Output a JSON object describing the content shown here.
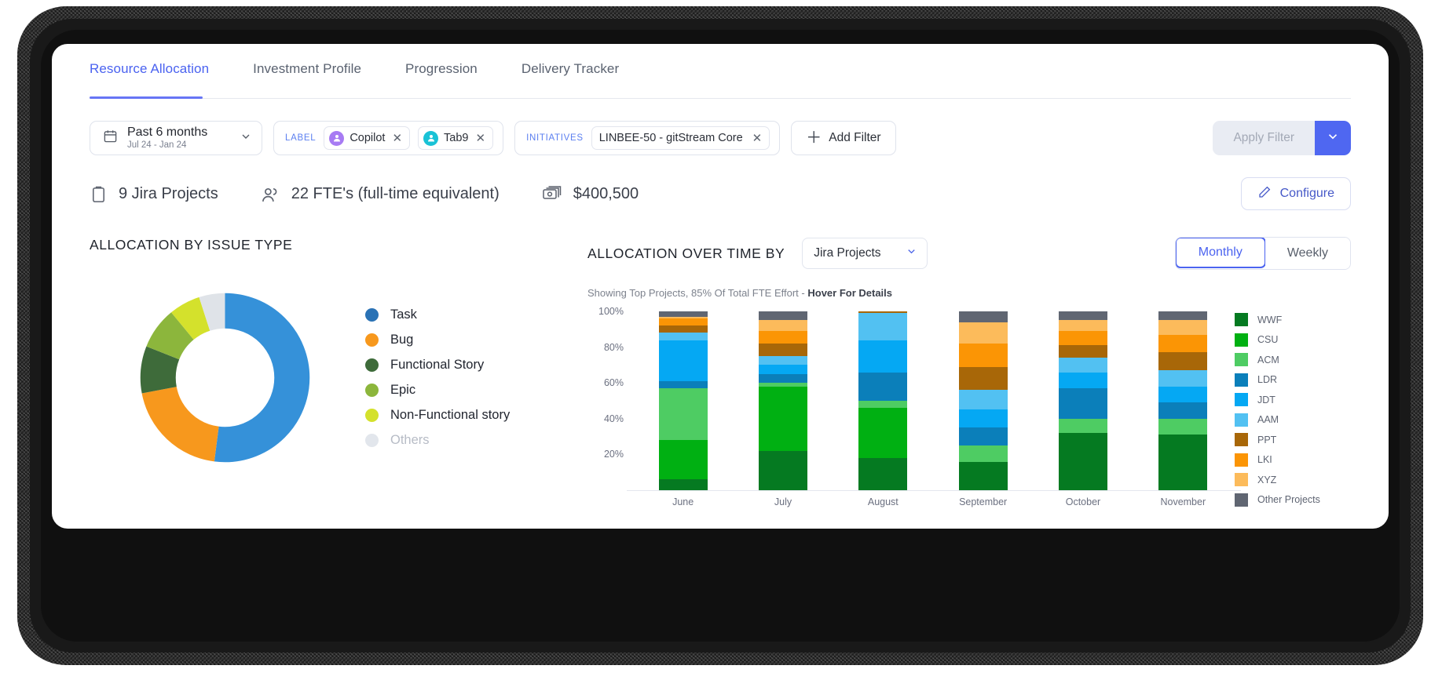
{
  "tabs": [
    {
      "label": "Resource Allocation",
      "active": true
    },
    {
      "label": "Investment Profile",
      "active": false
    },
    {
      "label": "Progression",
      "active": false
    },
    {
      "label": "Delivery Tracker",
      "active": false
    }
  ],
  "filters": {
    "date_range": {
      "title": "Past 6 months",
      "subtitle": "Jul 24 - Jan 24",
      "icon": "calendar-icon"
    },
    "label_group": {
      "label": "LABEL",
      "chips": [
        {
          "text": "Copilot",
          "avatar_color": "#a77bf3"
        },
        {
          "text": "Tab9",
          "avatar_color": "#19c2d6"
        }
      ]
    },
    "initiatives_group": {
      "label": "INITIATIVES",
      "chips": [
        {
          "text": "LINBEE-50 - gitStream Core"
        }
      ]
    },
    "add_filter": "Add Filter",
    "apply_filter": "Apply Filter",
    "apply_caret_color": "#4f67f1"
  },
  "stats": [
    {
      "icon": "clipboard-icon",
      "text": "9 Jira Projects"
    },
    {
      "icon": "people-icon",
      "text": "22 FTE's (full-time equivalent)"
    },
    {
      "icon": "money-icon",
      "text": "$400,500"
    }
  ],
  "configure_button": {
    "label": "Configure",
    "icon": "pencil-icon"
  },
  "left_panel": {
    "title": "ALLOCATION BY ISSUE TYPE"
  },
  "right_panel": {
    "title": "ALLOCATION OVER TIME BY",
    "group_by_selected": "Jira Projects",
    "period_monthly": "Monthly",
    "period_weekly": "Weekly",
    "subnote_plain": "Showing Top Projects, 85% Of Total FTE Effort  - ",
    "subnote_bold": "Hover For Details"
  },
  "chart_data": [
    {
      "type": "pie",
      "title": "ALLOCATION BY ISSUE TYPE",
      "donut": true,
      "legend_position": "right",
      "labels": [
        "Task",
        "Bug",
        "Functional Story",
        "Epic",
        "Non-Functional story",
        "Others"
      ],
      "values": [
        52,
        20,
        9,
        8,
        6,
        5
      ],
      "colors": [
        "#3591d9",
        "#f7981d",
        "#3e6b3a",
        "#8cb63c",
        "#d4e12c",
        "#dfe3e8"
      ],
      "legend_colors": [
        "#2a72b5",
        "#f7981d",
        "#3e6b3a",
        "#8cb63c",
        "#d4e12c",
        "#e2e6ec"
      ],
      "muted_labels": [
        "Others"
      ]
    },
    {
      "type": "bar",
      "stacked": true,
      "title": "ALLOCATION OVER TIME BY Jira Projects",
      "xlabel": "",
      "ylabel": "",
      "ylim": [
        0,
        100
      ],
      "yticks": [
        20,
        40,
        60,
        80,
        100
      ],
      "ytick_labels": [
        "20%",
        "40%",
        "60%",
        "80%",
        "100%"
      ],
      "grid": false,
      "legend_position": "right",
      "categories": [
        "June",
        "July",
        "August",
        "September",
        "October",
        "November"
      ],
      "series": [
        {
          "name": "WWF",
          "color": "#057a21",
          "values": [
            6,
            22,
            18,
            16,
            32,
            31
          ]
        },
        {
          "name": "CSU",
          "color": "#00b012",
          "values": [
            22,
            36,
            28,
            0,
            0,
            0
          ]
        },
        {
          "name": "ACM",
          "color": "#4ecc63",
          "values": [
            29,
            2,
            4,
            9,
            8,
            9
          ]
        },
        {
          "name": "LDR",
          "color": "#0b7fba",
          "values": [
            4,
            5,
            16,
            10,
            17,
            9
          ]
        },
        {
          "name": "JDT",
          "color": "#05a8f3",
          "values": [
            23,
            5,
            18,
            10,
            9,
            9
          ]
        },
        {
          "name": "AAM",
          "color": "#52c1f2",
          "values": [
            4,
            5,
            15,
            11,
            8,
            9
          ]
        },
        {
          "name": "PPT",
          "color": "#a86708",
          "values": [
            4,
            7,
            1,
            13,
            7,
            10
          ]
        },
        {
          "name": "LKI",
          "color": "#fb9505",
          "values": [
            4,
            7,
            0,
            13,
            8,
            10
          ]
        },
        {
          "name": "XYZ",
          "color": "#fcbb5b",
          "values": [
            1,
            6,
            0,
            12,
            6,
            8
          ]
        },
        {
          "name": "Other Projects",
          "color": "#606672",
          "values": [
            3,
            5,
            0,
            6,
            5,
            5
          ]
        }
      ]
    }
  ]
}
